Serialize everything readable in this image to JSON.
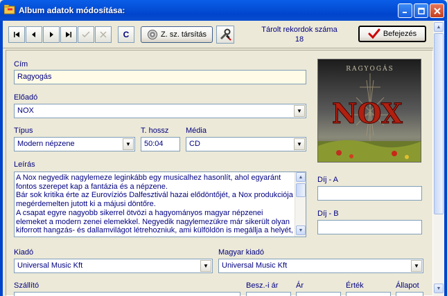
{
  "window": {
    "title": "Album adatok módosítása:"
  },
  "toolbar": {
    "nav_first": "|◀",
    "nav_prev": "◀",
    "nav_next": "▶",
    "nav_last": "▶|",
    "confirm": "✓",
    "cancel": "✕",
    "c_label": "C",
    "assoc_label": "Z. sz. társítás",
    "records_label": "Tárolt rekordok száma",
    "records_count": "18",
    "finish_label": "Befejezés"
  },
  "form": {
    "cim_label": "Cím",
    "cim_value": "Ragyogás",
    "eloado_label": "Előadó",
    "eloado_value": "NOX",
    "tipus_label": "Típus",
    "tipus_value": "Modern népzene",
    "thossz_label": "T. hossz",
    "thossz_value": "50:04",
    "media_label": "Média",
    "media_value": "CD",
    "leiras_label": "Leírás",
    "leiras_lines": [
      "A Nox negyedik nagylemeze leginkább egy musicalhez hasonlít, ahol egyaránt fontos szerepet kap a fantázia és a népzene.",
      "Bár sok kritika érte az Eurovíziós Dalfesztivál hazai elődöntőjét, a Nox produkciója megérdemelten jutott ki a májusi döntőre.",
      "A csapat egyre nagyobb sikerrel ötvözi a hagyományos magyar népzenei elemeket a modern zenei elemekkel. Negyedik nagylemezükre már sikerült olyan kiforrott hangzás- és dallamvilágot létrehozniuk, ami külföldön is megállja a helyét, és egyfajta"
    ],
    "dija_label": "Díj - A",
    "dija_value": "",
    "dijb_label": "Díj - B",
    "dijb_value": "",
    "kiado_label": "Kiadó",
    "kiado_value": "Universal Music Kft",
    "magyar_kiado_label": "Magyar kiadó",
    "magyar_kiado_value": "Universal Music Kft",
    "szallito_label": "Szállító",
    "besz_ar_label": "Besz.-i ár",
    "ar_label": "Ár",
    "ertek_label": "Érték",
    "allapot_label": "Állapot"
  },
  "cover": {
    "text": "RAGYOGÁS",
    "logo": "NOX"
  },
  "colors": {
    "titlebar": "#0044cc",
    "label": "#000080",
    "accent_check": "#cc0000"
  }
}
